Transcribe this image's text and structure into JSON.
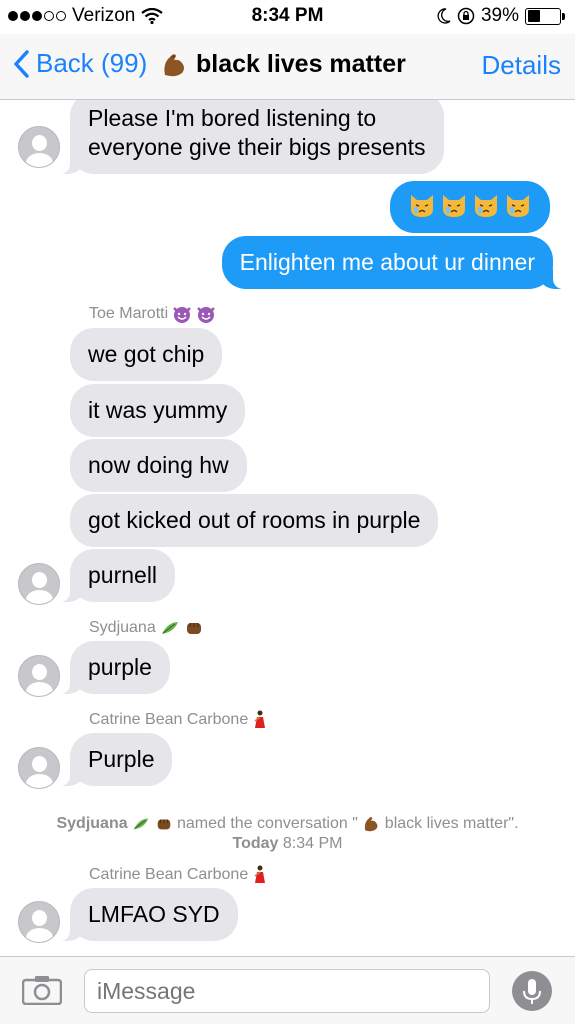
{
  "status_bar": {
    "carrier": "Verizon",
    "time": "8:34 PM",
    "battery": "39%",
    "battery_level": 0.39
  },
  "nav": {
    "back_label": "Back (99)",
    "title": "black lives matter",
    "title_emoji": "flexed-biceps-emoji",
    "details_label": "Details"
  },
  "messages": [
    {
      "dir": "in",
      "text_line1": "Please I'm bored listening to",
      "text_line2": "everyone give their bigs presents"
    },
    {
      "dir": "out",
      "text": "",
      "emojis": [
        "crying-cat-emoji",
        "crying-cat-emoji",
        "crying-cat-emoji",
        "crying-cat-emoji"
      ]
    },
    {
      "dir": "out",
      "text": "Enlighten me about ur dinner"
    },
    {
      "sender": "Toe Marotti",
      "sender_emojis": [
        "smiling-imp-emoji",
        "smiling-imp-emoji"
      ]
    },
    {
      "dir": "in",
      "text": "we got chip"
    },
    {
      "dir": "in",
      "text": "it was yummy"
    },
    {
      "dir": "in",
      "text": "now doing hw"
    },
    {
      "dir": "in",
      "text": "got kicked out of rooms in purple"
    },
    {
      "dir": "in",
      "text": "purnell"
    },
    {
      "sender": "Sydjuana",
      "sender_emojis": [
        "herb-emoji",
        "fist-emoji"
      ]
    },
    {
      "dir": "in",
      "text": "purple"
    },
    {
      "sender": "Catrine Bean Carbone",
      "sender_emojis": [
        "dancer-emoji"
      ]
    },
    {
      "dir": "in",
      "text": "Purple"
    },
    {
      "sender": "Catrine Bean Carbone",
      "sender_emojis": [
        "dancer-emoji"
      ]
    },
    {
      "dir": "in",
      "text": "LMFAO SYD"
    }
  ],
  "system_notice": {
    "actor": "Sydjuana",
    "action": "named the conversation \"",
    "name": "black lives matter\".",
    "day": "Today",
    "time": "8:34 PM"
  },
  "input": {
    "placeholder": "iMessage"
  },
  "colors": {
    "ios_blue": "#1a82fb",
    "outgoing_bubble": "#1d9bf6",
    "incoming_bubble": "#e5e5ea"
  }
}
